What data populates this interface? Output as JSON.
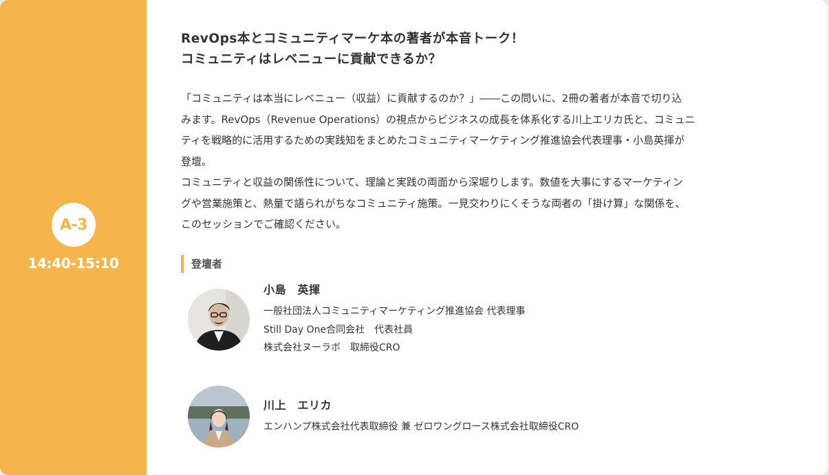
{
  "session": {
    "code": "A-3",
    "time": "14:40-15:10",
    "title_lines": [
      "RevOps本とコミュニティマーケ本の著者が本音トーク！",
      "コミュニティはレベニューに貢献できるか？"
    ],
    "description_lines": [
      "「コミュニティは本当にレベニュー（収益）に貢献するのか？」――この問いに、2冊の著者が本音で切り込",
      "みます。RevOps（Revenue Operations）の視点からビジネスの成長を体系化する川上エリカ氏と、コミュニ",
      "ティを戦略的に活用するための実践知をまとめたコミュニティマーケティング推進協会代表理事・小島英揮が",
      "登壇。",
      "コミュニティと収益の関係性について、理論と実践の両面から深堀りします。数値を大事にするマーケティン",
      "グや営業施策と、熱量で語られがちなコミュニティ施策。一見交わりにくそうな両者の「掛け算」な関係を、",
      "このセッションでご確認ください。"
    ]
  },
  "speakers_section": {
    "label": "登壇者",
    "speakers": [
      {
        "name": "小島　英揮",
        "roles": [
          "一般社団法人コミュニティマーケティング推進協会 代表理事",
          "Still Day One合同会社　代表社員",
          "株式会社ヌーラボ　取締役CRO"
        ]
      },
      {
        "name": "川上　エリカ",
        "roles": [
          "エンハンプ株式会社代表取締役 兼 ゼロワングロース株式会社取締役CRO"
        ]
      }
    ]
  },
  "colors": {
    "accent": "#f6b54a",
    "text": "#333333",
    "background": "#ffffff",
    "page_background": "#e9e9e9"
  }
}
